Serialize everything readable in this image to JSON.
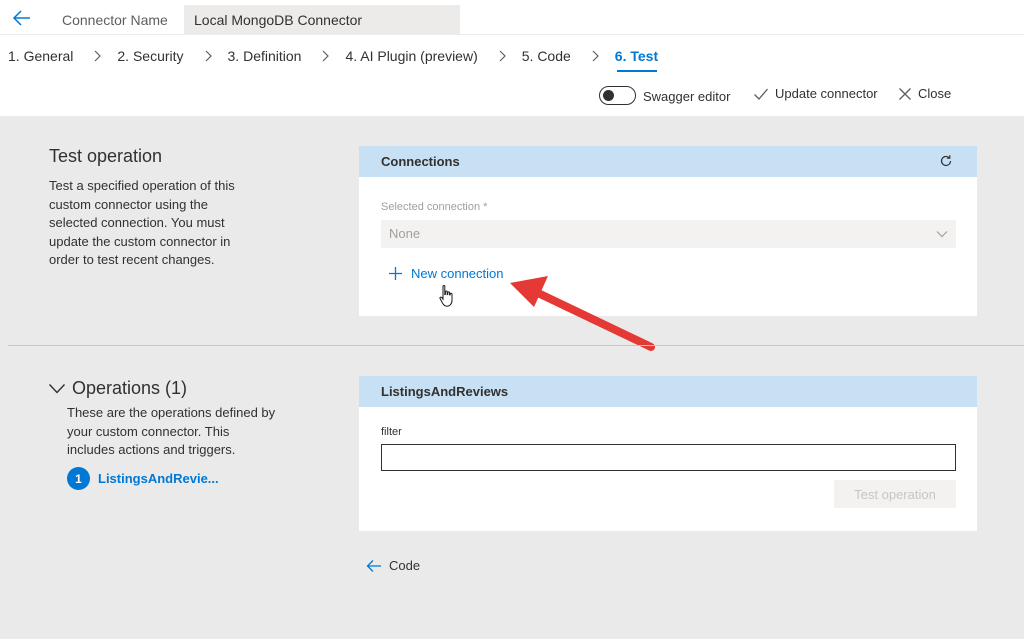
{
  "header": {
    "connector_name_label": "Connector Name",
    "connector_name_value": "Local MongoDB Connector"
  },
  "steps": [
    {
      "label": "1. General"
    },
    {
      "label": "2. Security"
    },
    {
      "label": "3. Definition"
    },
    {
      "label": "4. AI Plugin (preview)"
    },
    {
      "label": "5. Code"
    },
    {
      "label": "6. Test"
    }
  ],
  "toolbar": {
    "swagger_editor_label": "Swagger editor",
    "update_connector_label": "Update connector",
    "close_label": "Close"
  },
  "test_operation": {
    "title": "Test operation",
    "description": "Test a specified operation of this custom connector using the selected connection. You must update the custom connector in order to test recent changes."
  },
  "connections_card": {
    "header": "Connections",
    "selected_connection_label": "Selected connection *",
    "selected_connection_value": "None",
    "new_connection_label": "New connection"
  },
  "operations": {
    "title": "Operations (1)",
    "description": "These are the operations defined by your custom connector. This includes actions and triggers.",
    "items": [
      {
        "number": "1",
        "label": "ListingsAndRevie..."
      }
    ]
  },
  "operation_card": {
    "header": "ListingsAndReviews",
    "filter_label": "filter",
    "filter_value": "",
    "test_button_label": "Test operation"
  },
  "footer": {
    "back_label": "Code"
  },
  "colors": {
    "accent": "#0078d4",
    "card_header": "#c7e0f4",
    "annotation_arrow": "#e53935"
  }
}
